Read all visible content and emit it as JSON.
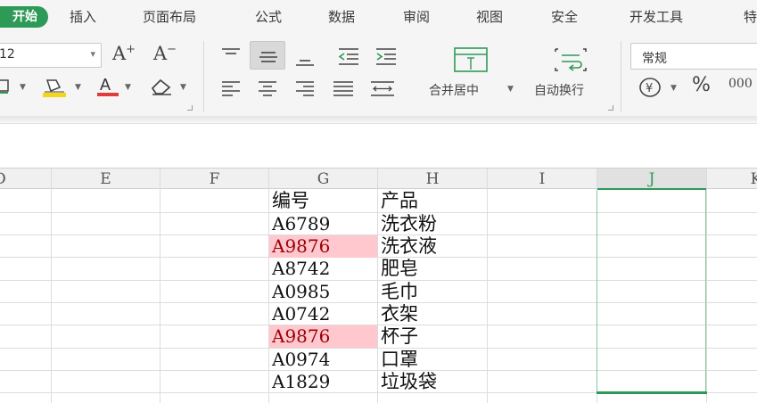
{
  "menubar": {
    "start_tab": "开始",
    "items": [
      "插入",
      "页面布局",
      "公式",
      "数据",
      "审阅",
      "视图",
      "安全",
      "开发工具",
      "特"
    ]
  },
  "ribbon": {
    "font_size": "12",
    "grow_font": "A",
    "shrink_font": "A",
    "merge_center_label": "合并居中",
    "wrap_text_label": "自动换行",
    "number_format": "常规",
    "currency_symbol": "¥",
    "percent_symbol": "%",
    "thousands_symbol": "000"
  },
  "columns": [
    "D",
    "E",
    "F",
    "G",
    "H",
    "I",
    "J",
    "K"
  ],
  "table": {
    "header": {
      "code": "编号",
      "product": "产品"
    },
    "rows": [
      {
        "code": "A6789",
        "product": "洗衣粉",
        "duplicate": false
      },
      {
        "code": "A9876",
        "product": "洗衣液",
        "duplicate": true
      },
      {
        "code": "A8742",
        "product": "肥皂",
        "duplicate": false
      },
      {
        "code": "A0985",
        "product": "毛巾",
        "duplicate": false
      },
      {
        "code": "A0742",
        "product": "衣架",
        "duplicate": false
      },
      {
        "code": "A9876",
        "product": "杯子",
        "duplicate": true
      },
      {
        "code": "A0974",
        "product": "口罩",
        "duplicate": false
      },
      {
        "code": "A1829",
        "product": "垃圾袋",
        "duplicate": false
      }
    ]
  },
  "colors": {
    "accent_green": "#2e9a58",
    "duplicate_fill": "#ffc7ce",
    "duplicate_text": "#9c0006",
    "font_color_red": "#e23b3b",
    "highlight_yellow": "#f5d617"
  },
  "icons": [
    "font-size-dropdown-icon",
    "grow-font-icon",
    "shrink-font-icon",
    "border-icon",
    "fill-color-icon",
    "font-color-icon",
    "eraser-icon",
    "align-top-icon",
    "align-middle-icon",
    "align-bottom-icon",
    "decrease-indent-icon",
    "increase-indent-icon",
    "align-left-icon",
    "align-center-icon",
    "align-right-icon",
    "justify-icon",
    "distributed-icon",
    "merge-center-icon",
    "wrap-text-icon",
    "currency-icon",
    "percent-icon",
    "thousands-icon"
  ]
}
